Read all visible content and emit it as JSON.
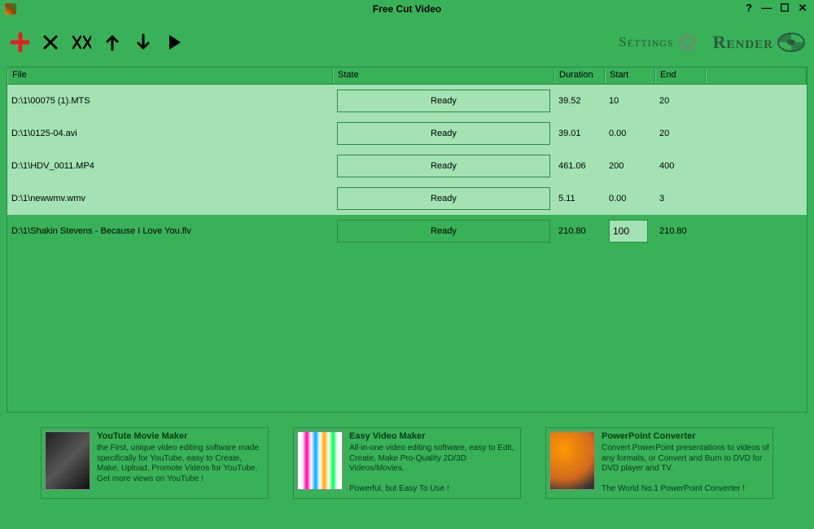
{
  "app": {
    "title": "Free Cut Video"
  },
  "toolbar": {
    "settings_label": "Settings",
    "render_label": "Render"
  },
  "table": {
    "headers": {
      "file": "File",
      "state": "State",
      "duration": "Duration",
      "start": "Start",
      "end": "End"
    },
    "rows": [
      {
        "file": "D:\\1\\00075 (1).MTS",
        "state": "Ready",
        "duration": "39.52",
        "start": "10",
        "end": "20",
        "selected": false
      },
      {
        "file": "D:\\1\\0125-04.avi",
        "state": "Ready",
        "duration": "39.01",
        "start": "0.00",
        "end": "20",
        "selected": false
      },
      {
        "file": "D:\\1\\HDV_0011.MP4",
        "state": "Ready",
        "duration": "461.06",
        "start": "200",
        "end": "400",
        "selected": false
      },
      {
        "file": "D:\\1\\newwmv.wmv",
        "state": "Ready",
        "duration": "5.11",
        "start": "0.00",
        "end": "3",
        "selected": false
      },
      {
        "file": "D:\\1\\Shakin Stevens - Because I Love You.flv",
        "state": "Ready",
        "duration": "210.80",
        "start": "100",
        "end": "210.80",
        "selected": true,
        "editing_start": true
      }
    ]
  },
  "promos": [
    {
      "title": "YouTute Movie Maker",
      "desc": "the First, unique video editing software made specifically for YouTube, easy to Create, Make, Upload, Promote Videos for YouTube.\nGet more views on YouTube !"
    },
    {
      "title": "Easy Video Maker",
      "desc": "All-in-one video editing software, easy to Edit, Create, Make Pro-Quality 2D/3D Videos/Movies.\n\nPowerful, but Easy To Use !"
    },
    {
      "title": "PowerPoint Converter",
      "desc": "Convert PowerPoint presentations to videos of any formats, or Convert and Burn to DVD for DVD player and TV.\n\nThe World No.1 PowerPoint Converter !"
    }
  ]
}
